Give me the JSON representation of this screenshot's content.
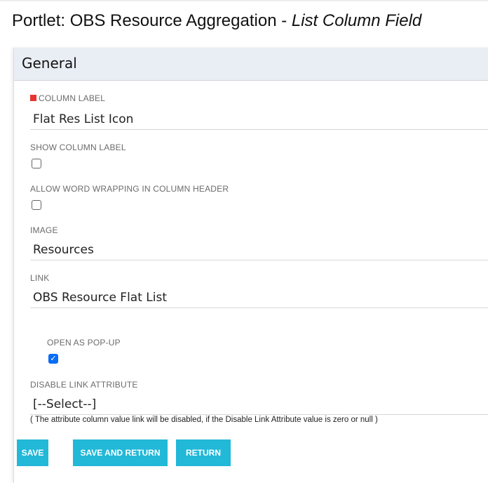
{
  "title": {
    "prefix": "Portlet: OBS Resource Aggregation - ",
    "italic": "List Column Field"
  },
  "section": "General",
  "fields": {
    "column_label": {
      "label": "COLUMN LABEL",
      "value": "Flat Res List Icon",
      "required": true
    },
    "show_column_label": {
      "label": "SHOW COLUMN LABEL",
      "checked": false
    },
    "allow_wrap": {
      "label": "ALLOW WORD WRAPPING IN COLUMN HEADER",
      "checked": false
    },
    "image": {
      "label": "IMAGE",
      "value": "Resources"
    },
    "link": {
      "label": "LINK",
      "value": "OBS Resource Flat List"
    },
    "open_popup": {
      "label": "OPEN AS POP-UP",
      "checked": true
    },
    "disable_link": {
      "label": "DISABLE LINK ATTRIBUTE",
      "value": "[--Select--]",
      "note": "( The attribute column value link will be disabled, if the Disable Link Attribute value is zero or null )"
    }
  },
  "buttons": {
    "save": "SAVE",
    "save_return": "SAVE AND RETURN",
    "return": "RETURN"
  },
  "colors": {
    "button": "#22b8d8",
    "header_bg": "#e9edf4",
    "required": "#e8342f",
    "checkbox": "#0b6cf5"
  }
}
